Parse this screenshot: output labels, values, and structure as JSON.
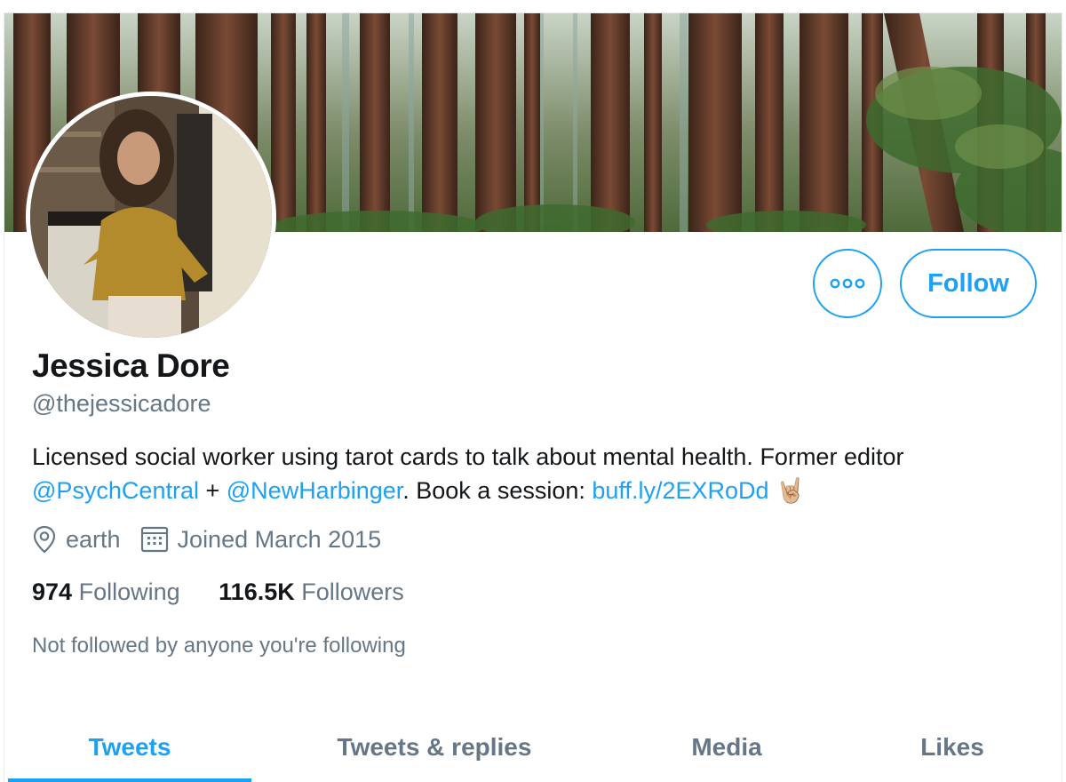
{
  "profile": {
    "name": "Jessica Dore",
    "handle": "@thejessicadore",
    "bio": {
      "line1": "Licensed social worker using tarot cards to talk about mental health. Former editor",
      "mention1": "@PsychCentral",
      "plus": " + ",
      "mention2": "@NewHarbinger",
      "book_text": ". Book a session: ",
      "url": "buff.ly/2EXRoDd",
      "emoji": "🤘🏼"
    },
    "location": "earth",
    "joined": "Joined March 2015"
  },
  "actions": {
    "more_icon": "more-horizontal-icon",
    "follow_label": "Follow"
  },
  "stats": {
    "following_count": "974",
    "following_label": "Following",
    "followers_count": "116.5K",
    "followers_label": "Followers"
  },
  "notice": "Not followed by anyone you're following",
  "tabs": [
    {
      "label": "Tweets",
      "active": true
    },
    {
      "label": "Tweets & replies",
      "active": false
    },
    {
      "label": "Media",
      "active": false
    },
    {
      "label": "Likes",
      "active": false
    }
  ],
  "colors": {
    "accent": "#1da1f2",
    "secondary_text": "#657786",
    "primary_text": "#14171a"
  }
}
